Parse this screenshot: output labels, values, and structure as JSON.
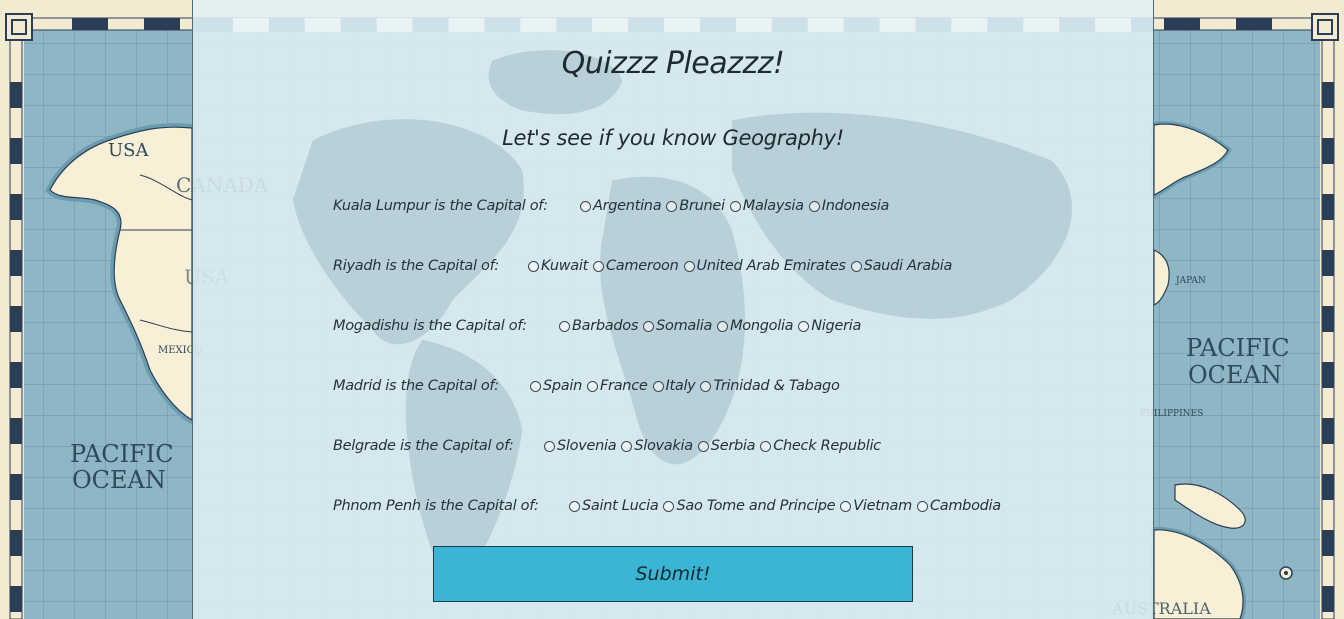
{
  "page": {
    "title": "Quizzz Pleazzz!",
    "subtitle": "Let's see if you know Geography!",
    "submit_label": "Submit!"
  },
  "questions": [
    {
      "text": "Kuala Lumpur is the Capital of:",
      "options": [
        "Argentina",
        "Brunei",
        "Malaysia",
        "Indonesia"
      ]
    },
    {
      "text": "Riyadh is the Capital of:",
      "options": [
        "Kuwait",
        "Cameroon",
        "United Arab Emirates",
        "Saudi Arabia"
      ]
    },
    {
      "text": "Mogadishu is the Capital of:",
      "options": [
        "Barbados",
        "Somalia",
        "Mongolia",
        "Nigeria"
      ]
    },
    {
      "text": "Madrid is the Capital of:",
      "options": [
        "Spain",
        "France",
        "Italy",
        "Trinidad & Tabago"
      ]
    },
    {
      "text": "Belgrade is the Capital of:",
      "options": [
        "Slovenia",
        "Slovakia",
        "Serbia",
        "Check Republic"
      ]
    },
    {
      "text": "Phnom Penh is the Capital of:",
      "options": [
        "Saint Lucia",
        "Sao Tome and Principe",
        "Vietnam",
        "Cambodia"
      ]
    }
  ],
  "map_labels": {
    "usa": "USA",
    "canada": "CANADA",
    "usa2": "USA",
    "mexico": "MEXICO",
    "pacific_left_1": "PACIFIC",
    "pacific_left_2": "OCEAN",
    "japan": "JAPAN",
    "pacific_right_1": "PACIFIC",
    "pacific_right_2": "OCEAN",
    "philippines": "PHILIPPINES",
    "australia": "AUSTRALIA"
  },
  "colors": {
    "ocean": "#8fb6c4",
    "land": "#f7efd6",
    "border_dark": "#2c3e56",
    "panel": "#e1f0f4",
    "button": "#3ab5d6"
  }
}
